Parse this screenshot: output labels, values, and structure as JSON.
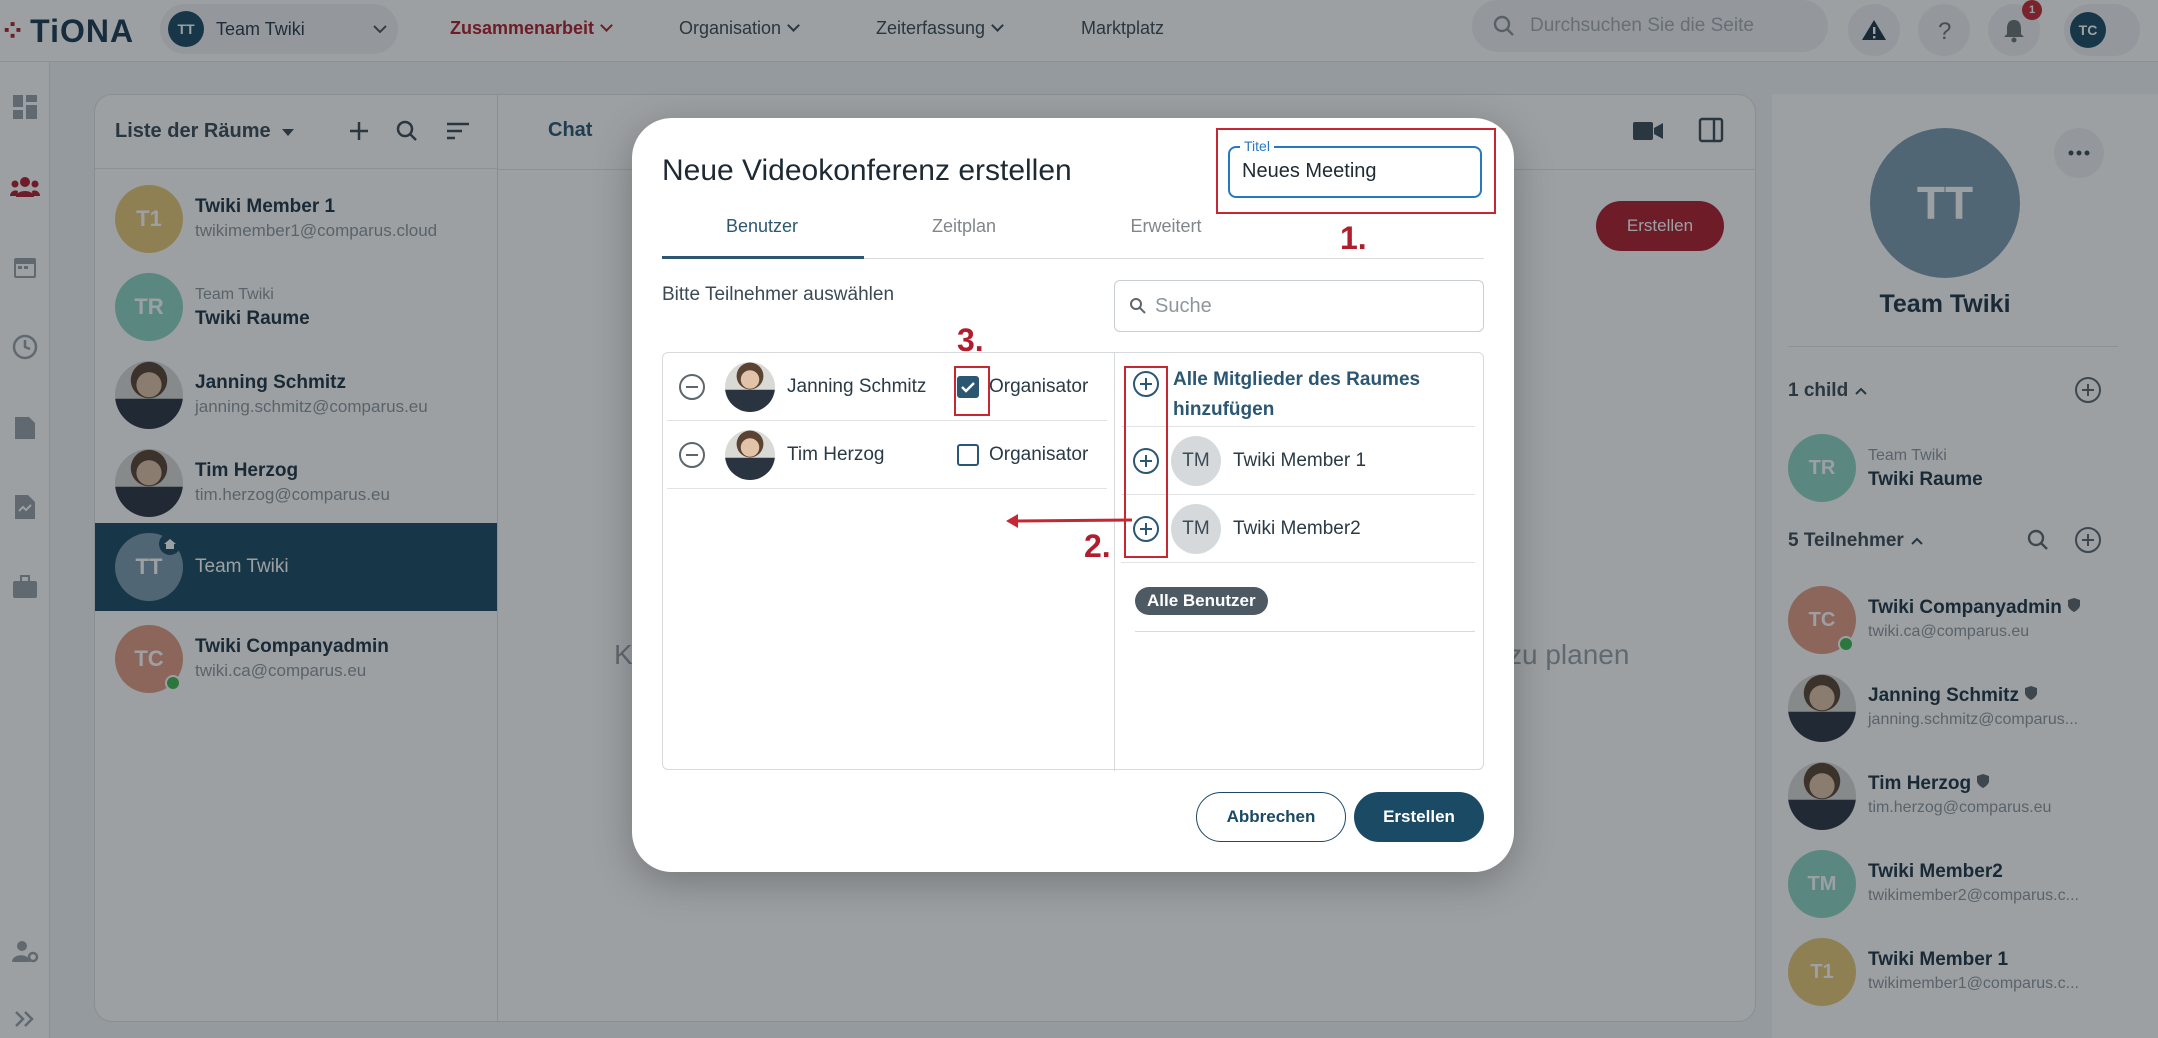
{
  "app": {
    "logo": "TiONA",
    "workspace": "Team Twiki",
    "workspace_avatar": "TT"
  },
  "nav": [
    "Zusammenarbeit",
    "Organisation",
    "Zeiterfassung",
    "Marktplatz"
  ],
  "search_placeholder": "Durchsuchen Sie die Seite",
  "notif_count": "1",
  "user_avatar": "TC",
  "rooms": {
    "header": "Liste der Räume",
    "items": [
      {
        "avatar": "T1",
        "name": "Twiki Member 1",
        "sub": "twikimember1@comparus.cloud",
        "color": "#e8c878"
      },
      {
        "avatar": "TR",
        "pre": "Team Twiki",
        "name": "Twiki Raume",
        "color": "#8ed6c4"
      },
      {
        "name": "Janning Schmitz",
        "sub": "janning.schmitz@comparus.eu"
      },
      {
        "name": "Tim Herzog",
        "sub": "tim.herzog@comparus.eu"
      },
      {
        "avatar": "TT",
        "name": "Team Twiki",
        "color": "#7d9bb0"
      },
      {
        "avatar": "TC",
        "name": "Twiki Companyadmin",
        "sub": "twiki.ca@comparus.eu",
        "color": "#e59b84"
      }
    ]
  },
  "chat": {
    "tab": "Chat",
    "create": "Erstellen",
    "bg_left": "K",
    "bg_right": "zu planen"
  },
  "right": {
    "avatar": "TT",
    "name": "Team Twiki",
    "children": "1 child",
    "child": {
      "avatar": "TR",
      "pre": "Team Twiki",
      "name": "Twiki Raume"
    },
    "participants": "5 Teilnehmer",
    "members": [
      {
        "avatar": "TC",
        "name": "Twiki Companyadmin",
        "sub": "twiki.ca@comparus.eu",
        "color": "#e59b84"
      },
      {
        "name": "Janning Schmitz",
        "sub": "janning.schmitz@comparus..."
      },
      {
        "name": "Tim Herzog",
        "sub": "tim.herzog@comparus.eu"
      },
      {
        "avatar": "TM",
        "name": "Twiki Member2",
        "sub": "twikimember2@comparus.c...",
        "color": "#8ed6c4"
      },
      {
        "avatar": "T1",
        "name": "Twiki Member 1",
        "sub": "twikimember1@comparus.c...",
        "color": "#e8c878"
      }
    ]
  },
  "dialog": {
    "title": "Neue Videokonferenz erstellen",
    "title_label": "Titel",
    "title_value": "Neues Meeting",
    "tabs": [
      "Benutzer",
      "Zeitplan",
      "Erweitert"
    ],
    "select_label": "Bitte Teilnehmer auswählen",
    "search_placeholder": "Suche",
    "selected": [
      {
        "name": "Janning Schmitz",
        "role": "Organisator",
        "checked": true
      },
      {
        "name": "Tim Herzog",
        "role": "Organisator",
        "checked": false
      }
    ],
    "add_all": "Alle Mitglieder des Raumes hinzufügen",
    "candidates": [
      {
        "avatar": "TM",
        "name": "Twiki Member 1"
      },
      {
        "avatar": "TM",
        "name": "Twiki Member2"
      }
    ],
    "chip": "Alle Benutzer",
    "cancel": "Abbrechen",
    "create": "Erstellen",
    "steps": [
      "1.",
      "2.",
      "3."
    ]
  },
  "colors": {
    "brand": "#1b4a64",
    "accent": "#b01d2c",
    "annotation": "#c62833",
    "link": "#2679c1"
  }
}
